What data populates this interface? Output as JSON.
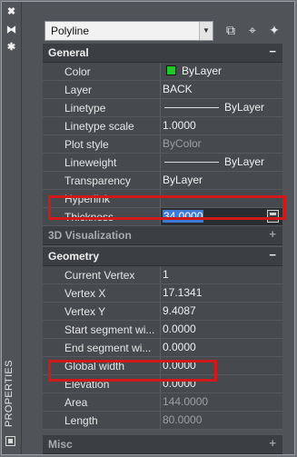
{
  "palette_title": "PROPERTIES",
  "object_type": "Polyline",
  "categories": {
    "general": {
      "label": "General",
      "toggle": "−"
    },
    "viz3d": {
      "label": "3D Visualization",
      "toggle": "+"
    },
    "geometry": {
      "label": "Geometry",
      "toggle": "−"
    },
    "misc": {
      "label": "Misc",
      "toggle": "+"
    }
  },
  "general": {
    "color": {
      "name": "Color",
      "value": "ByLayer",
      "swatch": "#22c52a"
    },
    "layer": {
      "name": "Layer",
      "value": "BACK"
    },
    "linetype": {
      "name": "Linetype",
      "value": "ByLayer"
    },
    "linetype_scale": {
      "name": "Linetype scale",
      "value": "1.0000"
    },
    "plot_style": {
      "name": "Plot style",
      "value": "ByColor"
    },
    "lineweight": {
      "name": "Lineweight",
      "value": "ByLayer"
    },
    "transparency": {
      "name": "Transparency",
      "value": "ByLayer"
    },
    "hyperlink": {
      "name": "Hyperlink",
      "value": ""
    },
    "thickness": {
      "name": "Thickness",
      "value": "34.0000"
    }
  },
  "geometry": {
    "current_vertex": {
      "name": "Current Vertex",
      "value": "1"
    },
    "vertex_x": {
      "name": "Vertex X",
      "value": "17.1341"
    },
    "vertex_y": {
      "name": "Vertex Y",
      "value": "9.4087"
    },
    "start_segment_width": {
      "name": "Start segment wi...",
      "value": "0.0000"
    },
    "end_segment_width": {
      "name": "End segment wi...",
      "value": "0.0000"
    },
    "global_width": {
      "name": "Global width",
      "value": "0.0000"
    },
    "elevation": {
      "name": "Elevation",
      "value": "0.0000"
    },
    "area": {
      "name": "Area",
      "value": "144.0000"
    },
    "length": {
      "name": "Length",
      "value": "80.0000"
    }
  }
}
